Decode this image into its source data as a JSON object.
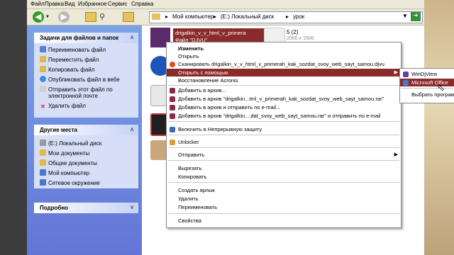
{
  "menu": [
    "Файл",
    "Правка",
    "Вид",
    "Избранное",
    "Сервис",
    "Справка"
  ],
  "address": {
    "parts": [
      "Мой компьютер",
      "(E:) Локальный диск",
      "урок"
    ]
  },
  "task_panel": {
    "title": "Задачи для файлов и папок",
    "items": [
      "Переименовать файл",
      "Переместить файл",
      "Копировать файл",
      "Опубликовать файл в вебе",
      "Отправить этот файл по",
      "электронной почте",
      "Удалить файл"
    ]
  },
  "places_panel": {
    "title": "Другие места",
    "items": [
      "(E:) Локальный диск",
      "Мои документы",
      "Общие документы",
      "Мой компьютер",
      "Сетевое окружение"
    ]
  },
  "details_panel": {
    "title": "Подробно"
  },
  "files": {
    "selected_name": "drigalkin_v_v_html_v_primera",
    "selected_type": "Файл \"DJVU\"",
    "image_name": "5 (2)",
    "image_size": "2000 x 1500"
  },
  "context_menu": {
    "items": [
      "Изменить",
      "Открыть",
      "Сканировать drigalkin_v_v_html_v_primerah_kak_sozdat_svoy_web_sayt_samou.djvu",
      "Открыть с помощью",
      "Восстановление Acronis",
      "Добавить в архив...",
      "Добавить в архив \"drigalkin...tml_v_primerah_kak_sozdat_svoy_web_sayt_samou.rar\"",
      "Добавить в архив и отправить по e-mail...",
      "Добавить в архив \"drigalkin....dat_svoy_web_sayt_samou.rar\" и отправить по e-mail",
      "Включить в Непрерывную защиту",
      "Unlocker",
      "Отправить",
      "Вырезать",
      "Копировать",
      "Создать ярлык",
      "Удалить",
      "Переименовать",
      "Свойства"
    ]
  },
  "submenu": {
    "items": [
      "WinDjView",
      "Microsoft Office",
      "Выбрать програм"
    ]
  }
}
